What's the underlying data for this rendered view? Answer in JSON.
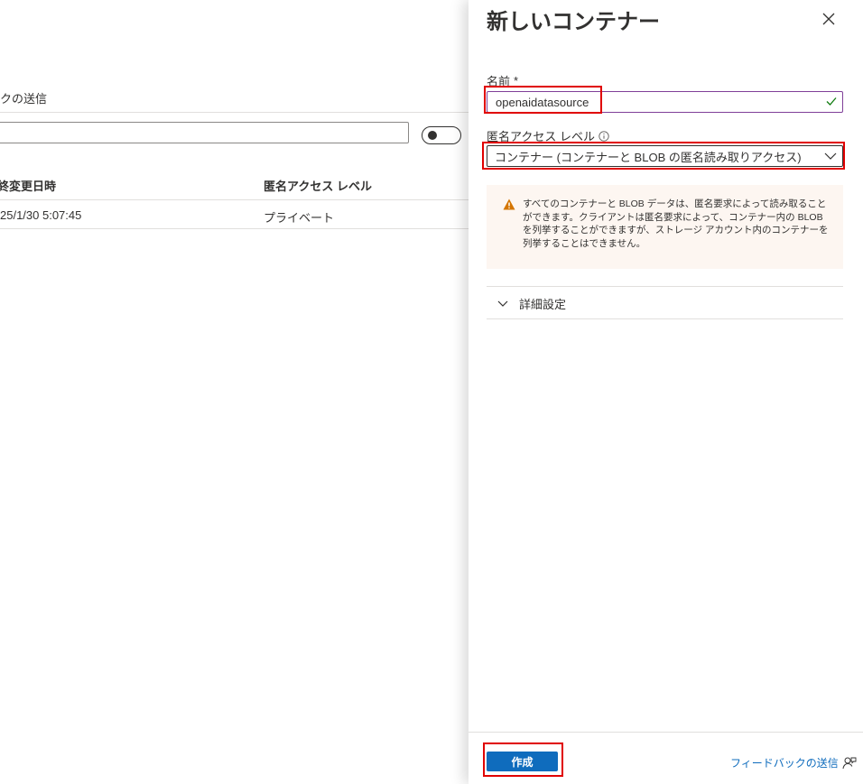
{
  "background": {
    "feedback_text": "クの送信",
    "table": {
      "headers": [
        "終変更日時",
        "匿名アクセス レベル"
      ],
      "rows": [
        [
          "25/1/30 5:07:45",
          "プライベート"
        ]
      ]
    }
  },
  "panel": {
    "title": "新しいコンテナー",
    "close_icon": "close-icon",
    "name_field": {
      "label": "名前",
      "required_marker": "*",
      "value": "openaidatasource",
      "valid_icon": "checkmark-icon"
    },
    "access_field": {
      "label": "匿名アクセス レベル",
      "info_icon": "info-icon",
      "selected": "コンテナー (コンテナーと BLOB の匿名読み取りアクセス)"
    },
    "warning": {
      "icon": "warning-icon",
      "text": "すべてのコンテナーと BLOB データは、匿名要求によって読み取ることができます。クライアントは匿名要求によって、コンテナー内の BLOB を列挙することができますが、ストレージ アカウント内のコンテナーを列挙することはできません。"
    },
    "advanced_label": "詳細設定",
    "create_label": "作成",
    "feedback_label": "フィードバックの送信"
  },
  "colors": {
    "accent": "#0f6cbd",
    "highlight": "#e00000",
    "warning_bg": "#fdf6f1",
    "warning_icon": "#d47500",
    "valid_check": "#107c10"
  }
}
